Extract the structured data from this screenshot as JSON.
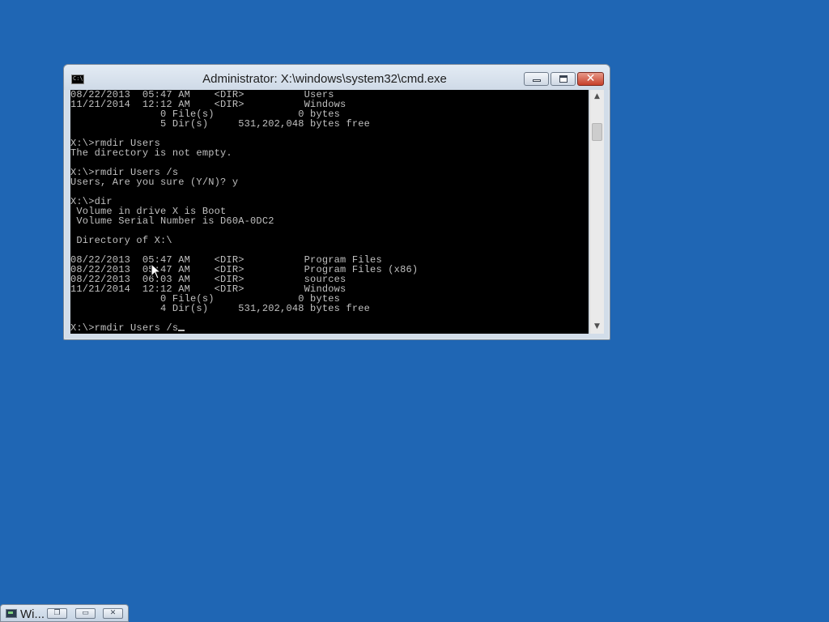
{
  "window": {
    "title": "Administrator: X:\\windows\\system32\\cmd.exe",
    "icon": "cmd-app-icon",
    "icon_text": "C:\\",
    "controls": {
      "minimize_icon": "minimize-icon",
      "maximize_icon": "maximize-icon",
      "close_icon": "close-icon",
      "close_glyph": "✕"
    }
  },
  "console": {
    "lines": [
      "08/22/2013  05:47 AM    <DIR>          Users",
      "11/21/2014  12:12 AM    <DIR>          Windows",
      "               0 File(s)              0 bytes",
      "               5 Dir(s)     531,202,048 bytes free",
      "",
      "X:\\>rmdir Users",
      "The directory is not empty.",
      "",
      "X:\\>rmdir Users /s",
      "Users, Are you sure (Y/N)? y",
      "",
      "X:\\>dir",
      " Volume in drive X is Boot",
      " Volume Serial Number is D60A-0DC2",
      "",
      " Directory of X:\\",
      "",
      "08/22/2013  05:47 AM    <DIR>          Program Files",
      "08/22/2013  05:47 AM    <DIR>          Program Files (x86)",
      "08/22/2013  06:03 AM    <DIR>          sources",
      "11/21/2014  12:12 AM    <DIR>          Windows",
      "               0 File(s)              0 bytes",
      "               4 Dir(s)     531,202,048 bytes free",
      "",
      "X:\\>rmdir Users /s"
    ],
    "text_color": "#c0c0c0",
    "background": "#000000"
  },
  "scrollbar": {
    "up_glyph": "▲",
    "down_glyph": "▼"
  },
  "taskbar": {
    "minimized_window_label": "Wi...",
    "restore_glyph": "❐",
    "maximize_glyph": "▭",
    "close_glyph": "✕"
  },
  "desktop": {
    "background": "#1f66b4"
  }
}
